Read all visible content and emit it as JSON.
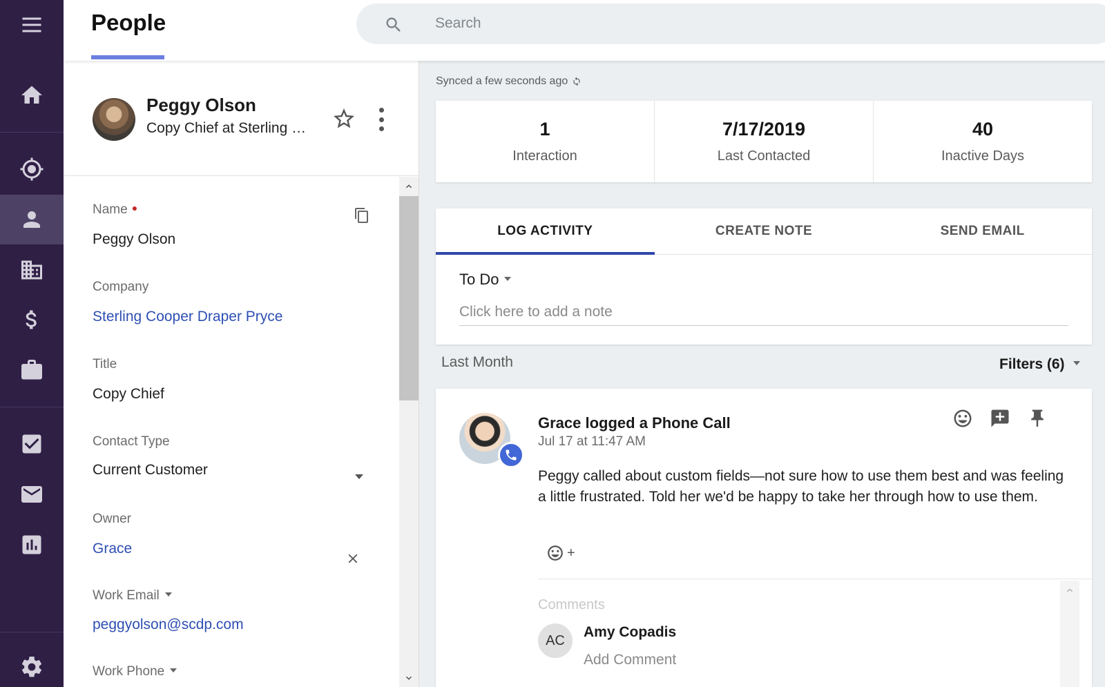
{
  "header": {
    "title": "People",
    "search_placeholder": "Search"
  },
  "sidebar": {
    "items": [
      {
        "icon": "menu-icon"
      },
      {
        "icon": "home-icon"
      },
      {
        "icon": "target-icon"
      },
      {
        "icon": "person-icon",
        "active": true
      },
      {
        "icon": "building-icon"
      },
      {
        "icon": "dollar-icon"
      },
      {
        "icon": "briefcase-icon"
      },
      {
        "icon": "checkbox-icon"
      },
      {
        "icon": "mail-icon"
      },
      {
        "icon": "chart-icon"
      },
      {
        "icon": "gear-icon"
      }
    ]
  },
  "profile": {
    "name": "Peggy Olson",
    "subtitle": "Copy Chief at Sterling Cooper Draper Pryce"
  },
  "fields": {
    "name_label": "Name",
    "name_value": "Peggy Olson",
    "company_label": "Company",
    "company_value": "Sterling Cooper Draper Pryce",
    "title_label": "Title",
    "title_value": "Copy Chief",
    "contact_type_label": "Contact Type",
    "contact_type_value": "Current Customer",
    "owner_label": "Owner",
    "owner_value": "Grace",
    "work_email_label": "Work Email",
    "work_email_value": "peggyolson@scdp.com",
    "work_phone_label": "Work Phone"
  },
  "sync": {
    "text": "Synced a few seconds ago"
  },
  "stats": [
    {
      "value": "1",
      "label": "Interaction"
    },
    {
      "value": "7/17/2019",
      "label": "Last Contacted"
    },
    {
      "value": "40",
      "label": "Inactive Days"
    }
  ],
  "activity": {
    "tabs": [
      "LOG ACTIVITY",
      "CREATE NOTE",
      "SEND EMAIL"
    ],
    "active_tab": "LOG ACTIVITY",
    "type": "To Do",
    "note_placeholder": "Click here to add a note"
  },
  "timeline": {
    "period": "Last Month",
    "filters": "Filters (6)"
  },
  "card": {
    "title": "Grace logged a Phone Call",
    "time": "Jul 17 at 11:47 AM",
    "body": "Peggy called about custom fields—not sure how to use them best and was feeling a little frustrated. Told her we'd be happy to take her through how to use them.",
    "react_plus": "+",
    "comments_label": "Comments",
    "comment_initials": "AC",
    "comment_author": "Amy Copadis",
    "comment_placeholder": "Add Comment"
  },
  "colors": {
    "sidebar": "#2f1f45",
    "sidebar_active": "#4d4266",
    "accent": "#6b7fe0",
    "tab_active": "#2f48a8",
    "link": "#2e4fb3",
    "call_badge": "#4267d6"
  }
}
